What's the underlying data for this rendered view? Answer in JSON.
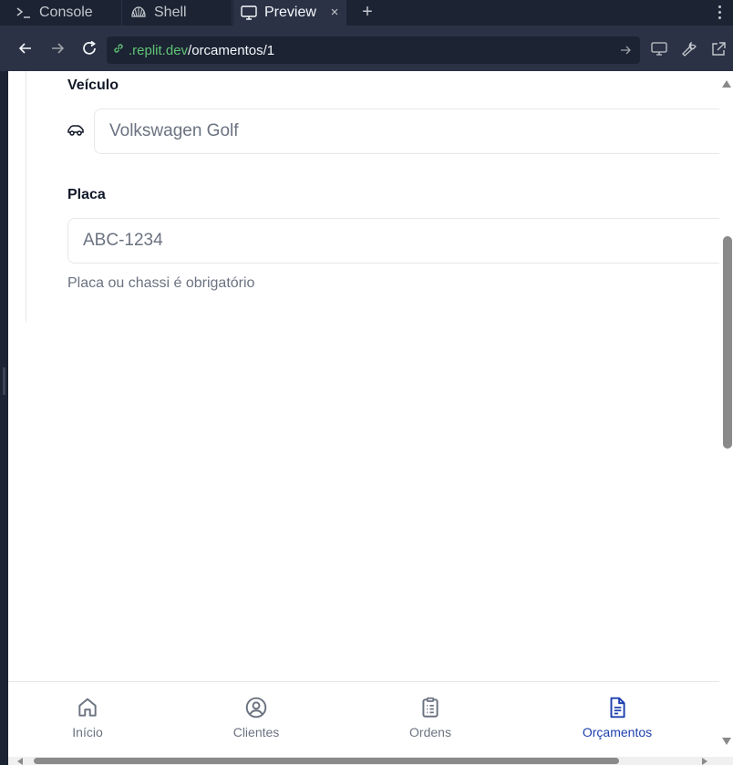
{
  "tabs": {
    "console": "Console",
    "shell": "Shell",
    "preview": "Preview",
    "close_glyph": "×",
    "add_glyph": "+"
  },
  "url": {
    "host": ".replit.dev",
    "path": "/orcamentos/1"
  },
  "form": {
    "vehicle_label": "Veículo",
    "vehicle_placeholder": "Volkswagen Golf",
    "plate_label": "Placa",
    "plate_placeholder": "ABC-1234",
    "plate_helper": "Placa ou chassi é obrigatório"
  },
  "bottom_nav": {
    "home": "Início",
    "clients": "Clientes",
    "orders": "Ordens",
    "quotes": "Orçamentos",
    "active": "quotes"
  },
  "colors": {
    "ide_bg": "#1c2333",
    "ide_panel": "#2b3245",
    "url_host": "#5fc476",
    "active_nav": "#1e40af",
    "muted_text": "#6b7280"
  },
  "icons": {
    "console": "terminal-prompt-icon",
    "shell": "shell-icon",
    "preview": "monitor-icon",
    "vehicle": "car-icon",
    "home": "home-icon",
    "clients": "user-circle-icon",
    "orders": "clipboard-list-icon",
    "quotes": "document-icon"
  }
}
